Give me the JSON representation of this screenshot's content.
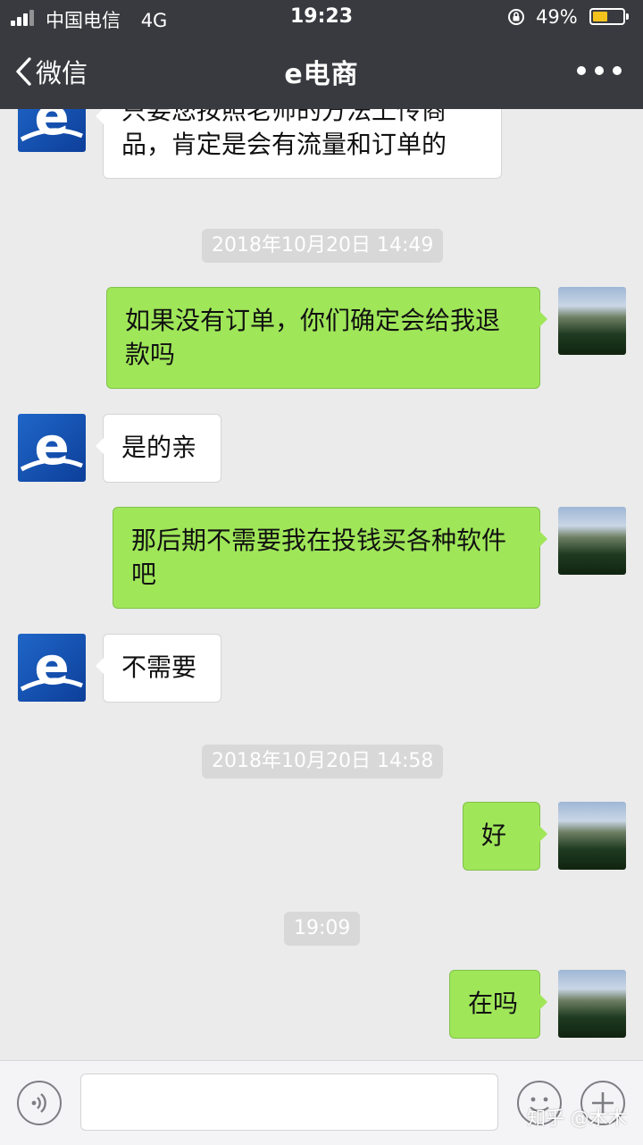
{
  "status_bar": {
    "carrier": "中国电信",
    "network": "4G",
    "time": "19:23",
    "battery": "49%",
    "battery_level": 0.49
  },
  "nav": {
    "back_label": "微信",
    "title": "e电商"
  },
  "messages": [
    {
      "type": "in",
      "avatar": "e-logo",
      "text": "只要您按照老师的方法上传商品，肯定是会有流量和订单的"
    },
    {
      "type": "time",
      "text": "2018年10月20日 14:49"
    },
    {
      "type": "out",
      "avatar": "photo",
      "text": "如果没有订单，你们确定会给我退款吗"
    },
    {
      "type": "in",
      "avatar": "e-logo",
      "text": "是的亲"
    },
    {
      "type": "out",
      "avatar": "photo",
      "text": "那后期不需要我在投钱买各种软件吧"
    },
    {
      "type": "in",
      "avatar": "e-logo",
      "text": "不需要"
    },
    {
      "type": "time",
      "text": "2018年10月20日 14:58"
    },
    {
      "type": "out",
      "avatar": "photo",
      "text": "好"
    },
    {
      "type": "time",
      "text": "19:09"
    },
    {
      "type": "out",
      "avatar": "photo",
      "text": "在吗"
    }
  ],
  "input_bar": {
    "voice_icon": "voice-icon",
    "emoji_icon": "emoji-icon",
    "plus_icon": "plus-icon"
  },
  "watermark": "知乎 @木木",
  "colors": {
    "top_bar": "#393a3f",
    "chat_background": "#ebebeb",
    "outgoing_bubble": "#9fe659",
    "incoming_bubble": "#ffffff",
    "battery_fill": "#f3c21c"
  }
}
